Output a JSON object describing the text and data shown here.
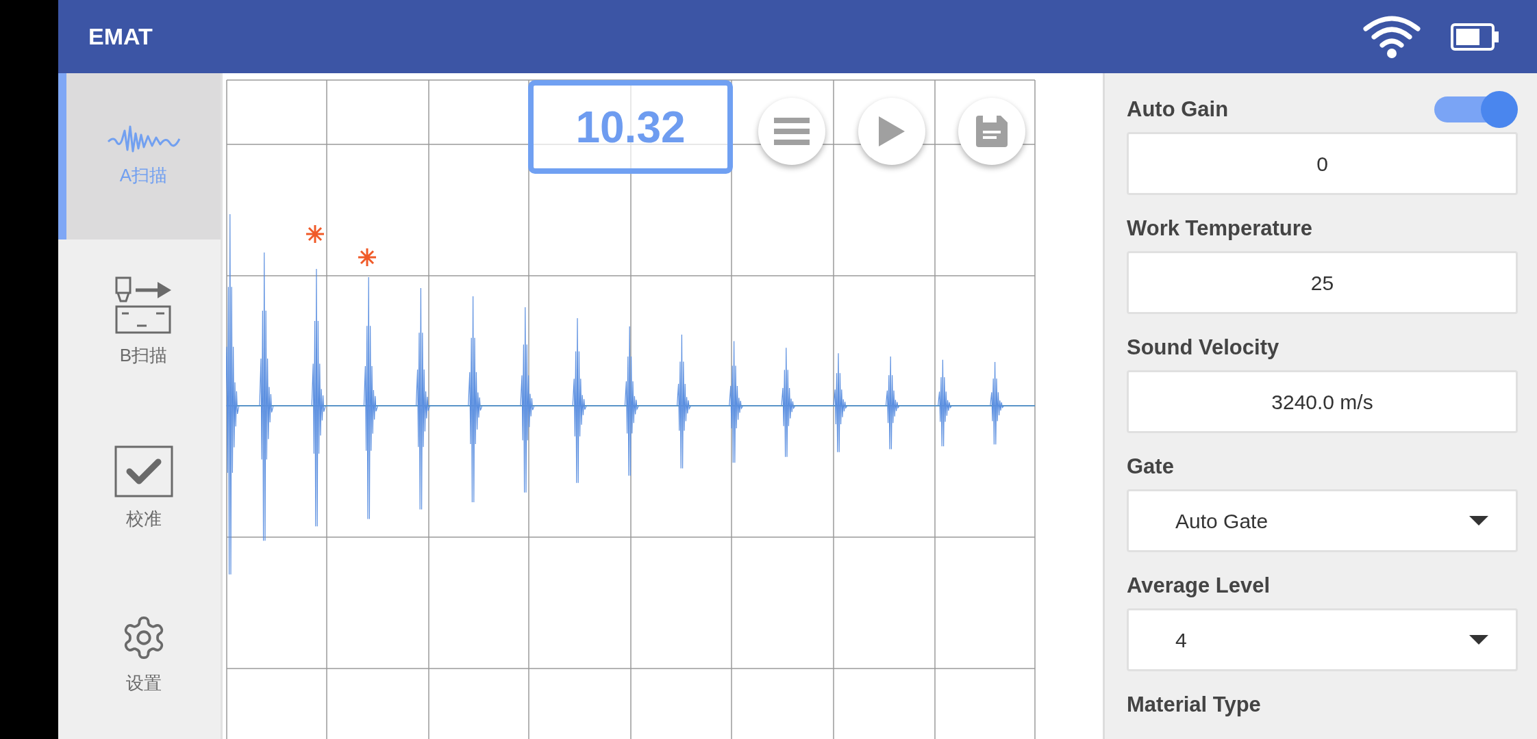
{
  "header": {
    "title": "EMAT"
  },
  "sidebar": {
    "items": [
      {
        "kind": "wave",
        "label": "A扫描",
        "selected": true
      },
      {
        "kind": "bscan",
        "label": "B扫描",
        "selected": false
      },
      {
        "kind": "check",
        "label": "校准",
        "selected": false
      },
      {
        "kind": "gear",
        "label": "设置",
        "selected": false
      }
    ]
  },
  "readout": "10.32",
  "settings": [
    {
      "label": "Auto Gain",
      "toggle": {
        "on": true
      },
      "field": {
        "kind": "input",
        "value": "0"
      }
    },
    {
      "label": "Work Temperature",
      "field": {
        "kind": "input",
        "value": "25"
      }
    },
    {
      "label": "Sound Velocity",
      "field": {
        "kind": "input",
        "value": "3240.0 m/s"
      }
    },
    {
      "label": "Gate",
      "field": {
        "kind": "dropdown",
        "value": "Auto Gate"
      }
    },
    {
      "label": "Average Level",
      "field": {
        "kind": "dropdown",
        "value": "4"
      }
    },
    {
      "label": "Material Type"
    }
  ]
}
